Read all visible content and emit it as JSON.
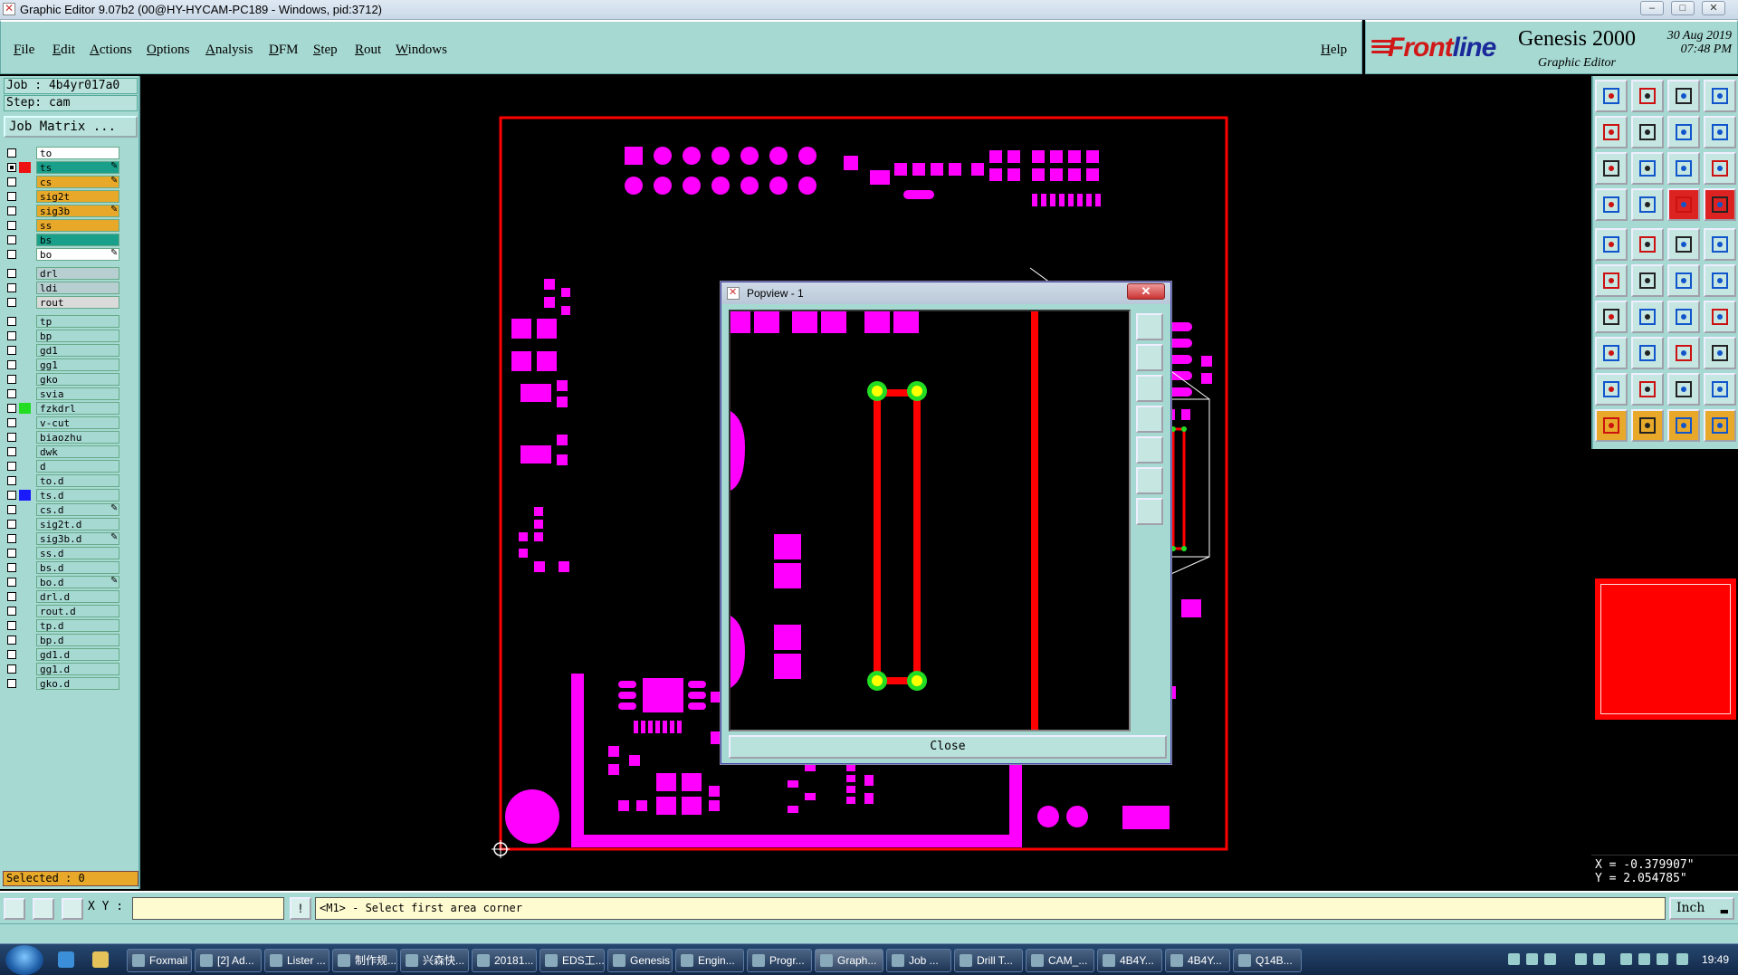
{
  "window": {
    "title": "Graphic Editor 9.07b2 (00@HY-HYCAM-PC189 - Windows, pid:3712)"
  },
  "menubar": {
    "items": [
      "File",
      "Edit",
      "Actions",
      "Options",
      "Analysis",
      "DFM",
      "Step",
      "Rout",
      "Windows"
    ],
    "help": "Help"
  },
  "brand": {
    "logo_prefix": "Front",
    "logo_suffix": "line",
    "product": "Genesis 2000",
    "subtitle": "Graphic Editor",
    "date": "30 Aug 2019",
    "time": "07:48 PM"
  },
  "job": {
    "job_label": "Job  : 4b4yr017a0",
    "step_label": "Step: cam",
    "matrix_button": "Job Matrix ..."
  },
  "layers": [
    {
      "name": "to",
      "bg": "#ffffff",
      "color": "",
      "pen": false
    },
    {
      "name": "ts",
      "bg": "#1aa08a",
      "color": "#ee1111",
      "pen": true,
      "active": true
    },
    {
      "name": "cs",
      "bg": "#e8a92a",
      "color": "",
      "pen": true
    },
    {
      "name": "sig2t",
      "bg": "#e8a92a",
      "color": "",
      "pen": false
    },
    {
      "name": "sig3b",
      "bg": "#e8a92a",
      "color": "",
      "pen": true
    },
    {
      "name": "ss",
      "bg": "#e8a92a",
      "color": "",
      "pen": false
    },
    {
      "name": "bs",
      "bg": "#1aa08a",
      "color": "",
      "pen": false
    },
    {
      "name": "bo",
      "bg": "#ffffff",
      "color": "",
      "pen": true
    },
    {
      "name": "drl",
      "bg": "#b8cfd2",
      "color": "",
      "pen": false,
      "gap": true
    },
    {
      "name": "ldi",
      "bg": "#b8cfd2",
      "color": "",
      "pen": false
    },
    {
      "name": "rout",
      "bg": "#dadada",
      "color": "",
      "pen": false
    },
    {
      "name": "tp",
      "bg": "#a6d9d2",
      "color": "",
      "pen": false,
      "gap": true
    },
    {
      "name": "bp",
      "bg": "#a6d9d2",
      "color": "",
      "pen": false
    },
    {
      "name": "gd1",
      "bg": "#a6d9d2",
      "color": "",
      "pen": false
    },
    {
      "name": "gg1",
      "bg": "#a6d9d2",
      "color": "",
      "pen": false
    },
    {
      "name": "gko",
      "bg": "#a6d9d2",
      "color": "",
      "pen": false
    },
    {
      "name": "svia",
      "bg": "#a6d9d2",
      "color": "",
      "pen": false
    },
    {
      "name": "fzkdrl",
      "bg": "#a6d9d2",
      "color": "#22dd22",
      "pen": false
    },
    {
      "name": "v-cut",
      "bg": "#a6d9d2",
      "color": "",
      "pen": false
    },
    {
      "name": "biaozhu",
      "bg": "#a6d9d2",
      "color": "",
      "pen": false
    },
    {
      "name": "dwk",
      "bg": "#a6d9d2",
      "color": "",
      "pen": false
    },
    {
      "name": "d",
      "bg": "#a6d9d2",
      "color": "",
      "pen": false
    },
    {
      "name": "to.d",
      "bg": "#a6d9d2",
      "color": "",
      "pen": false
    },
    {
      "name": "ts.d",
      "bg": "#a6d9d2",
      "color": "#1a1aff",
      "pen": false
    },
    {
      "name": "cs.d",
      "bg": "#a6d9d2",
      "color": "",
      "pen": true
    },
    {
      "name": "sig2t.d",
      "bg": "#a6d9d2",
      "color": "",
      "pen": false
    },
    {
      "name": "sig3b.d",
      "bg": "#a6d9d2",
      "color": "",
      "pen": true
    },
    {
      "name": "ss.d",
      "bg": "#a6d9d2",
      "color": "",
      "pen": false
    },
    {
      "name": "bs.d",
      "bg": "#a6d9d2",
      "color": "",
      "pen": false
    },
    {
      "name": "bo.d",
      "bg": "#a6d9d2",
      "color": "",
      "pen": true
    },
    {
      "name": "drl.d",
      "bg": "#a6d9d2",
      "color": "",
      "pen": false
    },
    {
      "name": "rout.d",
      "bg": "#a6d9d2",
      "color": "",
      "pen": false
    },
    {
      "name": "tp.d",
      "bg": "#a6d9d2",
      "color": "",
      "pen": false
    },
    {
      "name": "bp.d",
      "bg": "#a6d9d2",
      "color": "",
      "pen": false
    },
    {
      "name": "gd1.d",
      "bg": "#a6d9d2",
      "color": "",
      "pen": false
    },
    {
      "name": "gg1.d",
      "bg": "#a6d9d2",
      "color": "",
      "pen": false
    },
    {
      "name": "gko.d",
      "bg": "#a6d9d2",
      "color": "",
      "pen": false
    }
  ],
  "selected_label": "Selected : 0",
  "coords": {
    "x": "X = -0.379907\"",
    "y": "Y = 2.054785\""
  },
  "bottombar": {
    "xy_label": "X Y :",
    "xy_value": "",
    "prompt": "<M1> - Select first area corner",
    "units": "Inch"
  },
  "popview": {
    "title": "Popview - 1",
    "close_label": "Close"
  },
  "taskbar": {
    "apps": [
      "Foxmail",
      "[2] Ad...",
      "Lister ...",
      "制作规...",
      "兴森快...",
      "20181...",
      "EDS工...",
      "Genesis",
      "Engin...",
      "Progr...",
      "Graph...",
      "Job ...",
      "Drill T...",
      "CAM_...",
      "4B4Y...",
      "4B4Y...",
      "Q14B..."
    ],
    "clock": "19:49"
  },
  "colors": {
    "panel": "#a6d9d2",
    "pad": "#ff00ff",
    "trace": "#ff0000",
    "highlight": "#ffff00",
    "via": "#22dd22",
    "selected_bg": "#e8a92a"
  },
  "icons": {
    "toolbar": [
      "zoom-home-icon",
      "zoom-out-icon",
      "zoom-fit-icon",
      "view-split-icon",
      "pan-left-icon",
      "pan-right-icon",
      "redraw-icon",
      "snap-icon",
      "zoom-area-icon",
      "center-icon",
      "scale-icon",
      "query-icon",
      "measure-icon",
      "connect-icon",
      "net-icon",
      "net-select-icon",
      "display-icon",
      "flip-icon",
      "ruler-icon",
      "round-icon",
      "connect-nodes-icon",
      "cross-icon",
      "snap-point-icon",
      "snap-red-icon",
      "angle-icon",
      "line-icon",
      "arc-icon",
      "layer-icon",
      "feature-icon",
      "dash-icon",
      "box-icon",
      "pad-icon",
      "triangle-icon",
      "triangle-fill-icon",
      "triangle-b-icon",
      "triangle-c-icon",
      "pointer-icon",
      "pointer-b-icon",
      "pointer-c-icon",
      "pointer-d-icon"
    ]
  }
}
